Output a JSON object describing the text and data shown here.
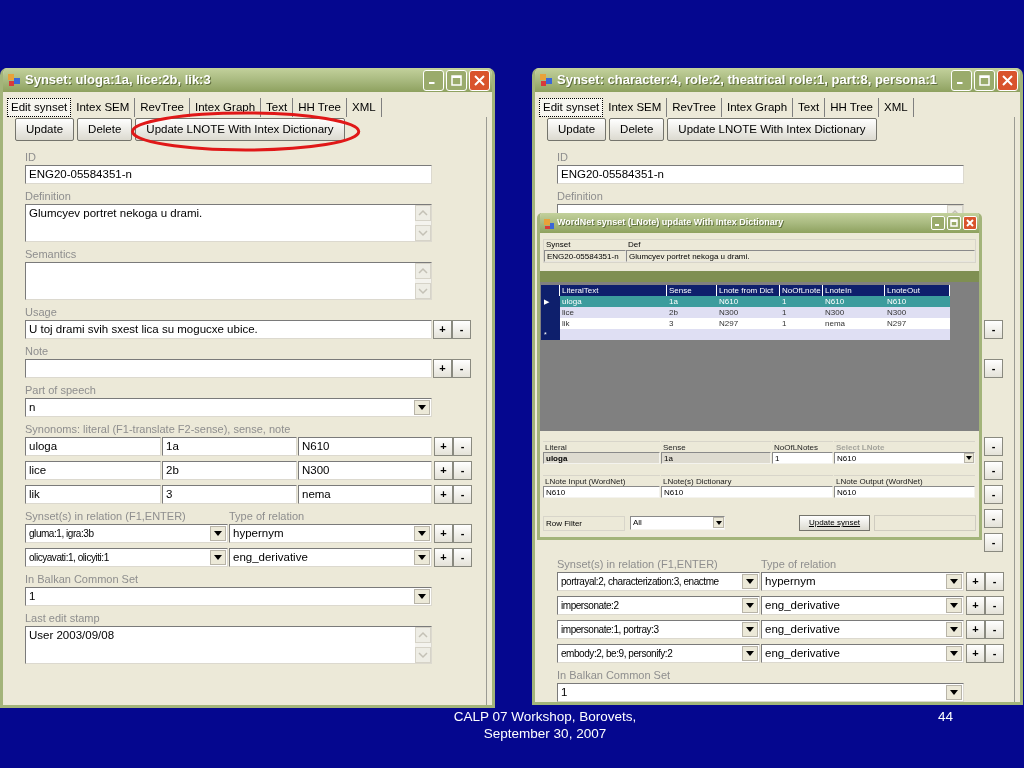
{
  "windows": [
    {
      "title": "Synset: uloga:1a, lice:2b, lik:3",
      "tabs": [
        {
          "label": "Edit synset",
          "selected": true
        },
        {
          "label": "Intex SEM",
          "selected": false
        },
        {
          "label": "RevTree",
          "selected": false
        },
        {
          "label": "Intex Graph",
          "selected": false
        },
        {
          "label": "Text",
          "selected": false
        },
        {
          "label": "HH Tree",
          "selected": false
        },
        {
          "label": "XML",
          "selected": false
        }
      ],
      "buttons": [
        {
          "label": "Update",
          "circled": false
        },
        {
          "label": "Delete",
          "circled": false
        },
        {
          "label": "Update LNOTE With Intex Dictionary",
          "circled": true
        }
      ],
      "sections": [
        {
          "kind": "text",
          "label": "ID",
          "value": "ENG20-05584351-n"
        },
        {
          "kind": "memo",
          "label": "Definition",
          "value": "Glumcyev portret nekoga u drami."
        },
        {
          "kind": "memo",
          "label": "Semantics"
        },
        {
          "kind": "text_pm",
          "label": "Usage",
          "value": "U toj drami svih sxest lica su mogucxe ubice.",
          "plus": "+",
          "minus": "-"
        },
        {
          "kind": "text_pm",
          "label": "Note",
          "plus": "+",
          "minus": "-"
        },
        {
          "kind": "combo",
          "label": "Part of speech",
          "value": "n"
        },
        {
          "kind": "synonyms",
          "label": "Synonoms: literal (F1-translate F2-sense), sense, note",
          "rows": [
            {
              "literal": "uloga",
              "sense": "1a",
              "note": "N610",
              "plus": "+",
              "minus": "-"
            },
            {
              "literal": "lice",
              "sense": "2b",
              "note": "N300",
              "plus": "+",
              "minus": "-"
            },
            {
              "literal": "lik",
              "sense": "3",
              "note": "nema",
              "plus": "+",
              "minus": "-"
            }
          ]
        },
        {
          "kind": "relations",
          "label": "Synset(s) in relation (F1,ENTER)",
          "type_label": "Type of relation",
          "rows": [
            {
              "synsets": "gluma:1, igra:3b",
              "type": "hypernym",
              "plus": "+",
              "minus": "-"
            },
            {
              "synsets": "olicyavati:1, olicyiti:1",
              "type": "eng_derivative",
              "plus": "+",
              "minus": "-"
            }
          ]
        },
        {
          "kind": "combo",
          "label": "In Balkan Common Set",
          "value": "1"
        },
        {
          "kind": "memo",
          "label": "Last edit stamp",
          "value": "User 2003/09/08"
        }
      ]
    },
    {
      "title": "Synset: character:4, role:2, theatrical role:1, part:8, persona:1",
      "tabs": [
        {
          "label": "Edit synset",
          "selected": true
        },
        {
          "label": "Intex SEM",
          "selected": false
        },
        {
          "label": "RevTree",
          "selected": false
        },
        {
          "label": "Intex Graph",
          "selected": false
        },
        {
          "label": "Text",
          "selected": false
        },
        {
          "label": "HH Tree",
          "selected": false
        },
        {
          "label": "XML",
          "selected": false
        }
      ],
      "buttons": [
        {
          "label": "Update",
          "circled": false
        },
        {
          "label": "Delete",
          "circled": false
        },
        {
          "label": "Update LNOTE With Intex Dictionary",
          "circled": false
        }
      ],
      "sections": [
        {
          "kind": "text",
          "label": "ID",
          "value": "ENG20-05584351-n"
        },
        {
          "kind": "memo",
          "label": "Definition"
        },
        {
          "kind": "covered_memo"
        },
        {
          "kind": "covered_row",
          "minus": "-"
        },
        {
          "kind": "covered_row",
          "minus": "-"
        },
        {
          "kind": "covered_row"
        },
        {
          "kind": "covered_row",
          "minus": "-"
        },
        {
          "kind": "covered_line",
          "minus": "-"
        },
        {
          "kind": "covered_line",
          "minus": "-"
        },
        {
          "kind": "covered_line",
          "minus": "-"
        },
        {
          "kind": "covered_line",
          "minus": "-"
        },
        {
          "kind": "relations",
          "label": "Synset(s) in relation (F1,ENTER)",
          "type_label": "Type of relation",
          "rows": [
            {
              "synsets": "portrayal:2, characterization:3, enactme",
              "type": "hypernym",
              "plus": "+",
              "minus": "-"
            },
            {
              "synsets": "impersonate:2",
              "type": "eng_derivative",
              "plus": "+",
              "minus": "-"
            },
            {
              "synsets": "impersonate:1, portray:3",
              "type": "eng_derivative",
              "plus": "+",
              "minus": "-"
            },
            {
              "synsets": "embody:2, be:9, personify:2",
              "type": "eng_derivative",
              "plus": "+",
              "minus": "-"
            }
          ]
        },
        {
          "kind": "combo",
          "label": "In Balkan Common Set",
          "value": "1"
        }
      ]
    }
  ],
  "dialog": {
    "title": "WordNet synset (LNote) update With Intex Dictionary",
    "header": {
      "labels": [
        "Synset",
        "Def"
      ],
      "values": [
        "ENG20-05584351-n",
        "Glumcyev portret nekoga u drami."
      ]
    },
    "grid": {
      "columns": [
        "LiteralText",
        "Sense",
        "Lnote from Dict",
        "NoOfLnote",
        "LnoteIn",
        "LnoteOut"
      ],
      "rows": [
        {
          "marker": "▶",
          "cells": [
            "uloga",
            "1a",
            "N610",
            "1",
            "N610",
            "N610"
          ],
          "selected": true
        },
        {
          "cells": [
            "lice",
            "2b",
            "N300",
            "1",
            "N300",
            "N300"
          ],
          "selected": false
        },
        {
          "cells": [
            "lik",
            "3",
            "N297",
            "1",
            "nema",
            "N297"
          ],
          "selected": false
        },
        {
          "marker": "*",
          "cells": [],
          "selected": false
        }
      ]
    },
    "detail_rows": [
      [
        {
          "label": "Literal",
          "value": "uloga",
          "kind": "key",
          "disabled": false
        },
        {
          "label": "Sense",
          "value": "1a",
          "kind": "readonly",
          "disabled": false
        },
        {
          "label": "NoOfLNotes",
          "value": "1",
          "kind": "input",
          "disabled": false
        },
        {
          "label": "Select LNote",
          "value": "N610",
          "kind": "combo",
          "disabled": true
        }
      ],
      [
        {
          "label": "LNote Input (WordNet)",
          "value": "N610",
          "kind": "input",
          "disabled": false
        },
        {
          "label": "LNote(s) Dictionary",
          "value": "N610",
          "kind": "input",
          "disabled": false
        },
        {
          "label": "LNote Output (WordNet)",
          "value": "N610",
          "kind": "input",
          "disabled": false
        }
      ]
    ],
    "filter": {
      "label": "Row Filter",
      "value": "All"
    },
    "update_button": "Update synset"
  },
  "footer": {
    "lines": [
      "CALP 07 Workshop, Borovets,",
      "September 30, 2007"
    ],
    "page_number": "44"
  }
}
